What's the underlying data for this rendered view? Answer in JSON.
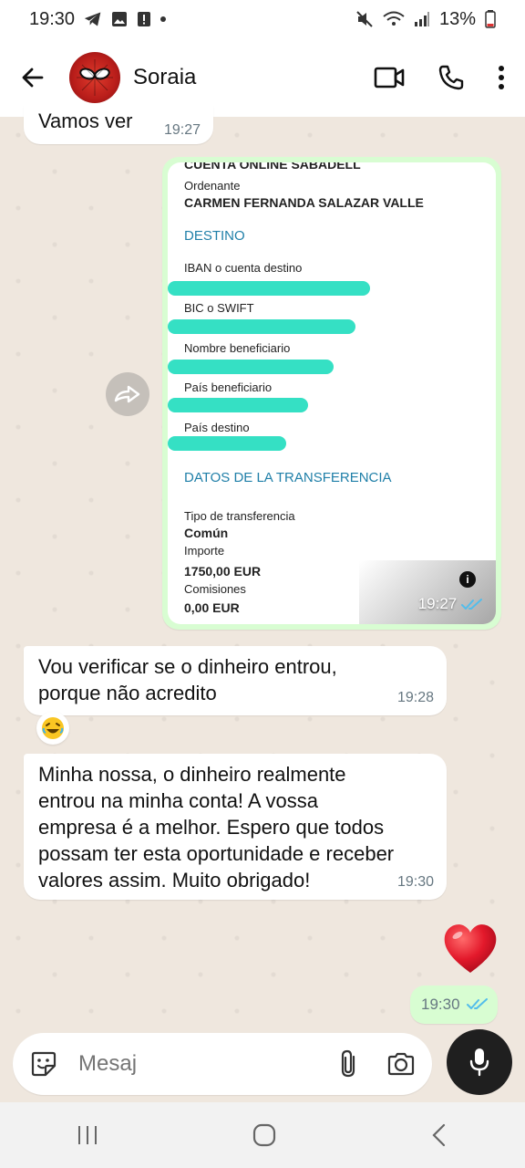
{
  "status": {
    "time": "19:30",
    "battery": "13%"
  },
  "header": {
    "contact_name": "Soraia"
  },
  "messages": {
    "partial_text": "Vamos ver",
    "partial_time": "19:27",
    "image": {
      "doc_header": "CUENTA ONLINE SABADELL",
      "ordenante_label": "Ordenante",
      "ordenante_value": "CARMEN FERNANDA SALAZAR VALLE",
      "destino": "DESTINO",
      "iban": "IBAN o cuenta destino",
      "bic": "BIC o SWIFT",
      "nombre": "Nombre beneficiario",
      "pais_benef": "País beneficiario",
      "pais_dest": "País destino",
      "datos": "DATOS DE LA TRANSFERENCIA",
      "tipo_label": "Tipo de transferencia",
      "tipo_value": "Común",
      "importe_label": "Importe",
      "importe_value": "1750,00 EUR",
      "comisiones_label": "Comisiones",
      "comisiones_value": "0,00 EUR",
      "info": "i",
      "time": "19:27"
    },
    "msg1_line1": "Vou verificar se o dinheiro entrou,",
    "msg1_line2": "porque não acredito",
    "msg1_time": "19:28",
    "msg2_lines": [
      "Minha nossa, o dinheiro realmente",
      "entrou na minha conta! A vossa",
      "empresa é a melhor. Espero que todos",
      "possam ter esta oportunidade e receber",
      "valores assim. Muito obrigado!"
    ],
    "msg2_time": "19:30",
    "sent_time": "19:30"
  },
  "composer": {
    "placeholder": "Mesaj"
  },
  "colors": {
    "sent_bubble": "#d8fdd2",
    "received_bubble": "#ffffff",
    "read_ticks": "#53bdeb",
    "redaction": "#35e0c4"
  }
}
